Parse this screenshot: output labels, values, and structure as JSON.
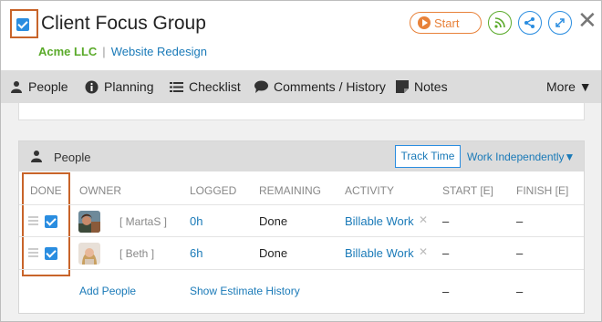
{
  "header": {
    "title": "Client Focus Group",
    "client": "Acme LLC",
    "separator": "|",
    "project": "Website Redesign",
    "start_label": "Start",
    "close_glyph": "✕"
  },
  "nav": {
    "items": [
      {
        "label": "People",
        "icon": "person-icon"
      },
      {
        "label": "Planning",
        "icon": "info-icon"
      },
      {
        "label": "Checklist",
        "icon": "list-icon"
      },
      {
        "label": "Comments / History",
        "icon": "chat-icon"
      },
      {
        "label": "Notes",
        "icon": "note-icon"
      }
    ],
    "more_label": "More ▼"
  },
  "people_panel": {
    "title": "People",
    "track_time": "Track Time",
    "work_independently": "Work Independently▼",
    "columns": [
      "DONE",
      "OWNER",
      "LOGGED",
      "REMAINING",
      "ACTIVITY",
      "START [E]",
      "FINISH [E]"
    ],
    "rows": [
      {
        "owner": "[ MartaS ]",
        "logged": "0h",
        "remaining": "Done",
        "activity": "Billable Work",
        "remove": "✕",
        "start": "–",
        "finish": "–",
        "done": true
      },
      {
        "owner": "[ Beth ]",
        "logged": "6h",
        "remaining": "Done",
        "activity": "Billable Work",
        "remove": "✕",
        "start": "–",
        "finish": "–",
        "done": true
      }
    ],
    "footer": {
      "add_people": "Add People",
      "show_history": "Show Estimate History",
      "start": "–",
      "finish": "–"
    }
  },
  "colors": {
    "accent_blue": "#2a8de0",
    "link_blue": "#1a7ab8",
    "client_green": "#5aaa2a",
    "start_orange": "#e8823a",
    "highlight": "#c8642a"
  }
}
